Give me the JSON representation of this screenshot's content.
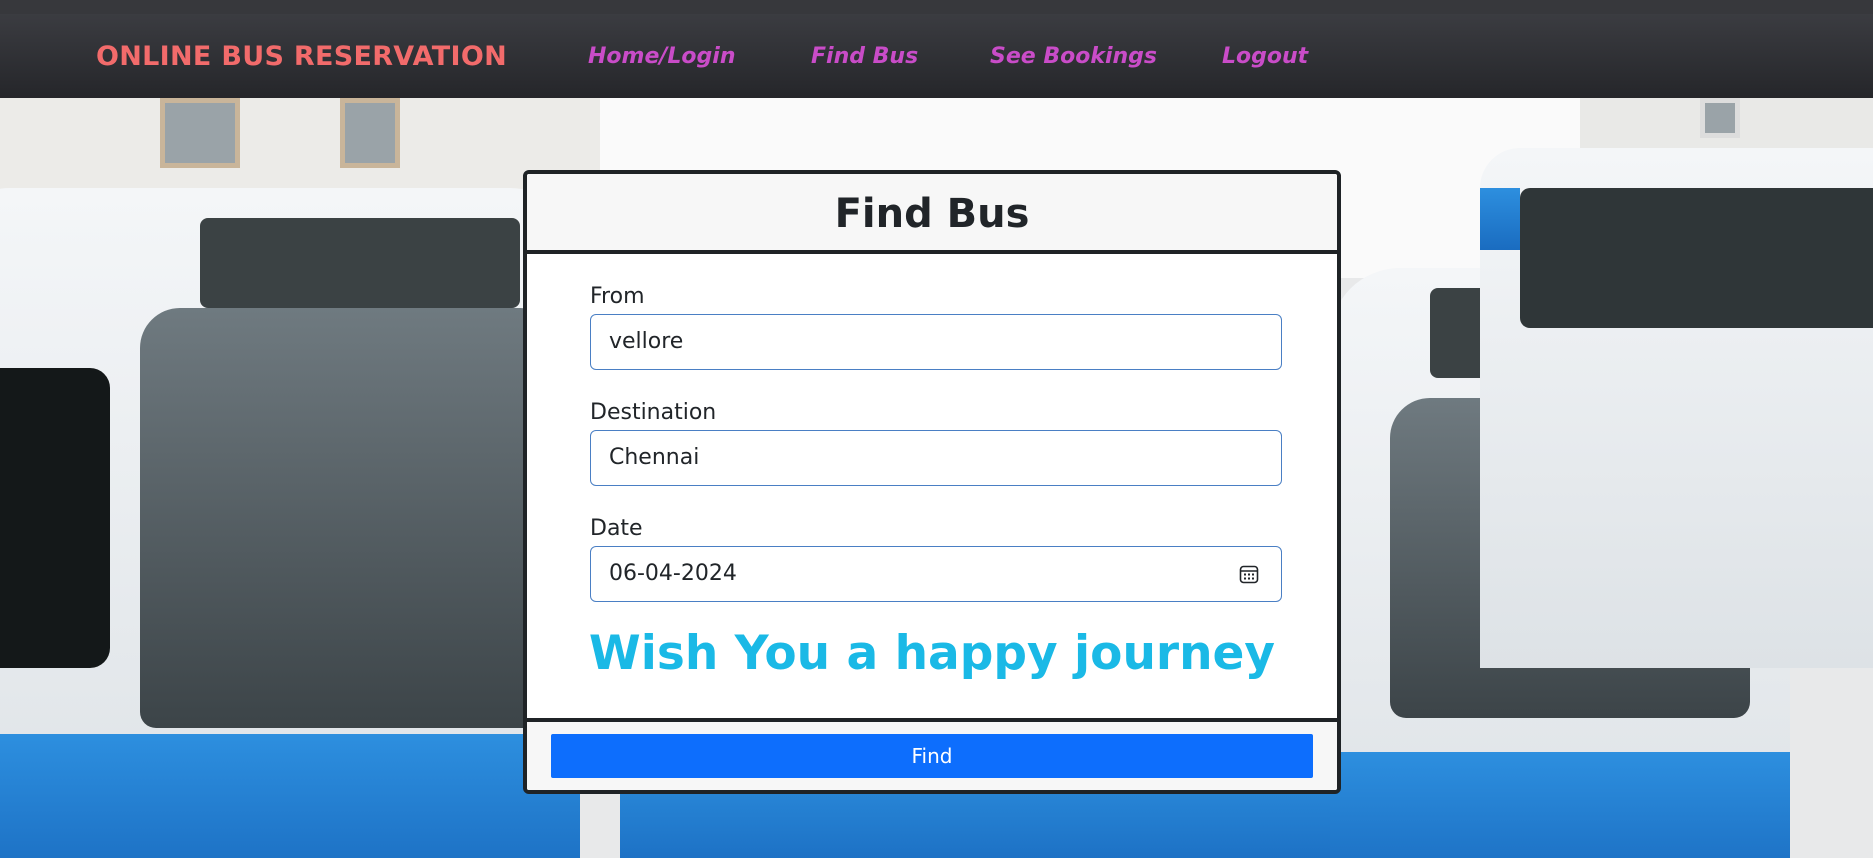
{
  "nav": {
    "brand": "ONLINE BUS RESERVATION",
    "links": [
      "Home/Login",
      "Find Bus",
      "See Bookings",
      "Logout"
    ]
  },
  "form": {
    "title": "Find Bus",
    "from_label": "From",
    "from_value": "vellore",
    "destination_label": "Destination",
    "destination_value": "Chennai",
    "date_label": "Date",
    "date_value": "06-04-2024",
    "message": "Wish You a happy journey",
    "submit_label": "Find"
  },
  "colors": {
    "brand": "#f26b6b",
    "nav_link": "#c94cc8",
    "message": "#1ab9e6",
    "button": "#0d6efd"
  }
}
